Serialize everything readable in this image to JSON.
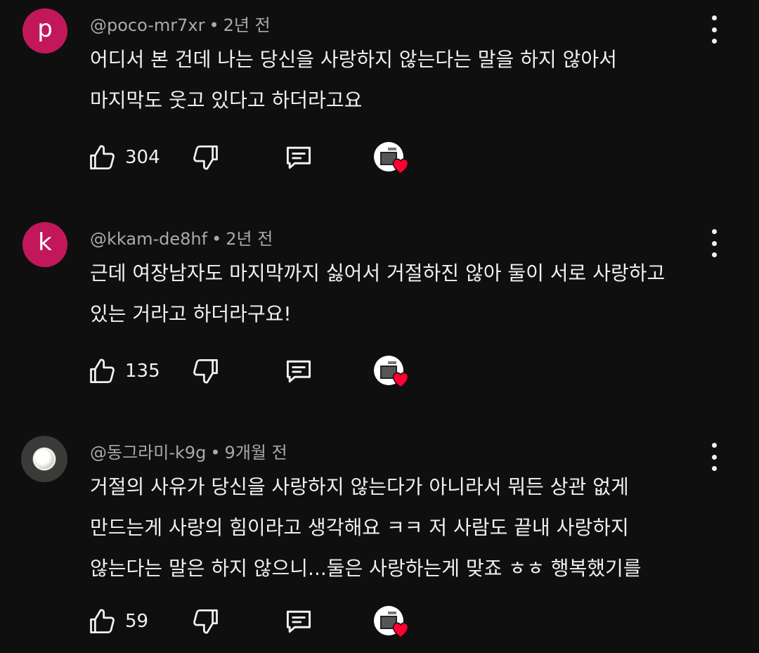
{
  "colors": {
    "background": "#0f0f0f",
    "text": "#f1f1f1",
    "meta": "#aaaaaa",
    "avatar_p": "#c2185b",
    "avatar_k": "#c2185b",
    "heart": "#ff0033"
  },
  "comments": [
    {
      "avatar": {
        "type": "letter",
        "letter": "p",
        "color": "#c2185b"
      },
      "handle": "@poco-mr7xr",
      "separator": "•",
      "time": "2년 전",
      "lines": [
        "어디서 본 건데 나는 당신을 사랑하지 않는다는 말을 하지 않아서",
        "마지막도 웃고 있다고 하더라고요"
      ],
      "likes": "304",
      "icons": [
        "like-icon",
        "dislike-icon",
        "reply-icon",
        "creator-heart-icon",
        "more-vert-icon"
      ]
    },
    {
      "avatar": {
        "type": "letter",
        "letter": "k",
        "color": "#c2185b"
      },
      "handle": "@kkam-de8hf",
      "separator": "•",
      "time": "2년 전",
      "lines": [
        "근데 여장남자도 마지막까지 싫어서 거절하진 않아 둘이 서로 사랑하고",
        "있는 거라고 하더라구요!"
      ],
      "likes": "135",
      "icons": [
        "like-icon",
        "dislike-icon",
        "reply-icon",
        "creator-heart-icon",
        "more-vert-icon"
      ]
    },
    {
      "avatar": {
        "type": "photo",
        "description_icon": "moon-avatar-icon"
      },
      "handle": "@동그라미-k9g",
      "separator": "•",
      "time": "9개월 전",
      "lines": [
        "거절의 사유가 당신을 사랑하지 않는다가 아니라서 뭐든 상관 없게",
        "만드는게 사랑의 힘이라고 생각해요 ㅋㅋ 저 사람도 끝내 사랑하지",
        "않는다는 말은 하지 않으니...둘은 사랑하는게 맞죠 ㅎㅎ 행복했기를"
      ],
      "likes": "59",
      "icons": [
        "like-icon",
        "dislike-icon",
        "reply-icon",
        "creator-heart-icon",
        "more-vert-icon"
      ]
    }
  ]
}
